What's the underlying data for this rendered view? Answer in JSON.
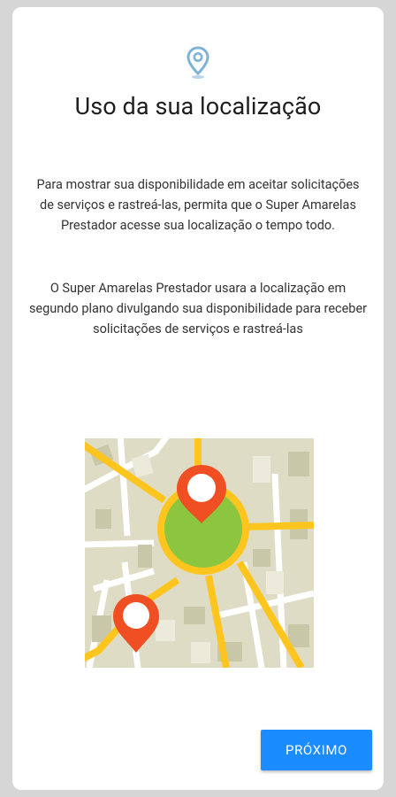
{
  "screen": {
    "icon": "location-pin-icon",
    "title": "Uso da sua localização",
    "paragraph_1": "Para mostrar sua disponibilidade em aceitar solicitações de serviços e rastreá-las, permita que o Super Amarelas Prestador acesse sua localização o tempo todo.",
    "paragraph_2": "O  Super Amarelas Prestador usara a localização em segundo plano divulgando sua disponibilidade para receber solicitações de serviços e rastreá-las",
    "illustration": "map-illustration"
  },
  "footer": {
    "next_label": "PRÓXIMO"
  },
  "colors": {
    "accent": "#1a8cff",
    "map_background": "#dedcc5",
    "road": "#ffc51f",
    "pin": "#f04e23",
    "area": "#8cc63e"
  }
}
